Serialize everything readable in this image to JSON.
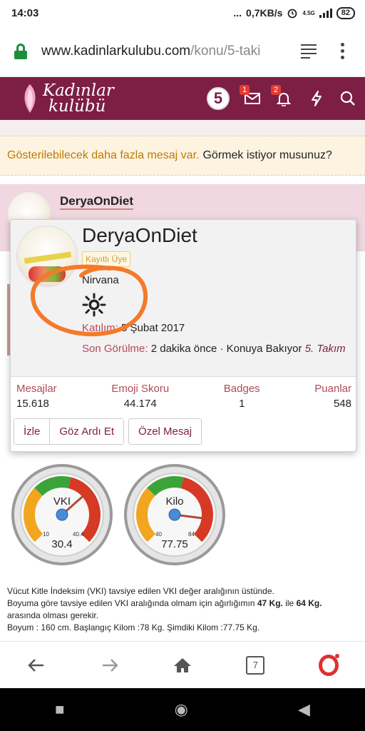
{
  "status": {
    "time": "14:03",
    "dots": "...",
    "speed": "0,7KB/s",
    "network": "4.5G",
    "battery": "82"
  },
  "browser": {
    "domain": "www.kadinlarkulubu.com",
    "path": "/konu/5-taki"
  },
  "site": {
    "logo_line1": "Kadınlar",
    "logo_line2": "kulübü",
    "messages_badge": "1",
    "alerts_badge": "2",
    "avatar_glyph": "5"
  },
  "notice": {
    "hint": "Gösterilebilecek daha fazla mesaj var.",
    "ask": "Görmek istiyor musunuz?"
  },
  "post": {
    "author": "DeryaOnDiet"
  },
  "profile_card": {
    "username": "DeryaOnDiet",
    "role": "Kayıtlı Üye",
    "user_title": "Nirvana",
    "joined_label": "Katılım:",
    "joined_value": "5 Şubat 2017",
    "seen_label": "Son Görülme:",
    "seen_value": "2 dakika önce · Konuya Bakıyor",
    "seen_link": "5. Takım",
    "stats": [
      {
        "label": "Mesajlar",
        "value": "15.618"
      },
      {
        "label": "Emoji Skoru",
        "value": "44.174"
      },
      {
        "label": "Badges",
        "value": "1"
      },
      {
        "label": "Puanlar",
        "value": "548"
      }
    ],
    "buttons": {
      "follow": "İzle",
      "ignore": "Göz Ardı Et",
      "message": "Özel Mesaj"
    }
  },
  "gauges": [
    {
      "label": "VKI",
      "value": "30.4",
      "min": "10",
      "max": "40.4",
      "needle_fraction": 0.68
    },
    {
      "label": "Kilo",
      "value": "77.75",
      "min": "40",
      "max": "84",
      "needle_fraction": 0.86
    }
  ],
  "bmi_text": {
    "line1": "Vücut Kitle İndeksim (VKI) tavsiye edilen VKI değer aralığının üstünde.",
    "line2_a": "Boyuma göre tavsiye edilen VKI aralığında olmam için ağırlığımın",
    "line2_b": "47 Kg.",
    "line2_c": "ile",
    "line2_d": "64 Kg.",
    "line2_e": "arasında olması gerekir.",
    "line3": "Boyum : 160 cm. Başlangıç Kilom :78 Kg. Şimdiki Kilom :77.75 Kg."
  },
  "nav": {
    "tabs_count": "7"
  },
  "colors": {
    "brand": "#7d1e45",
    "annotation": "#f47a2a",
    "notice_bg": "#fdf3e1"
  }
}
